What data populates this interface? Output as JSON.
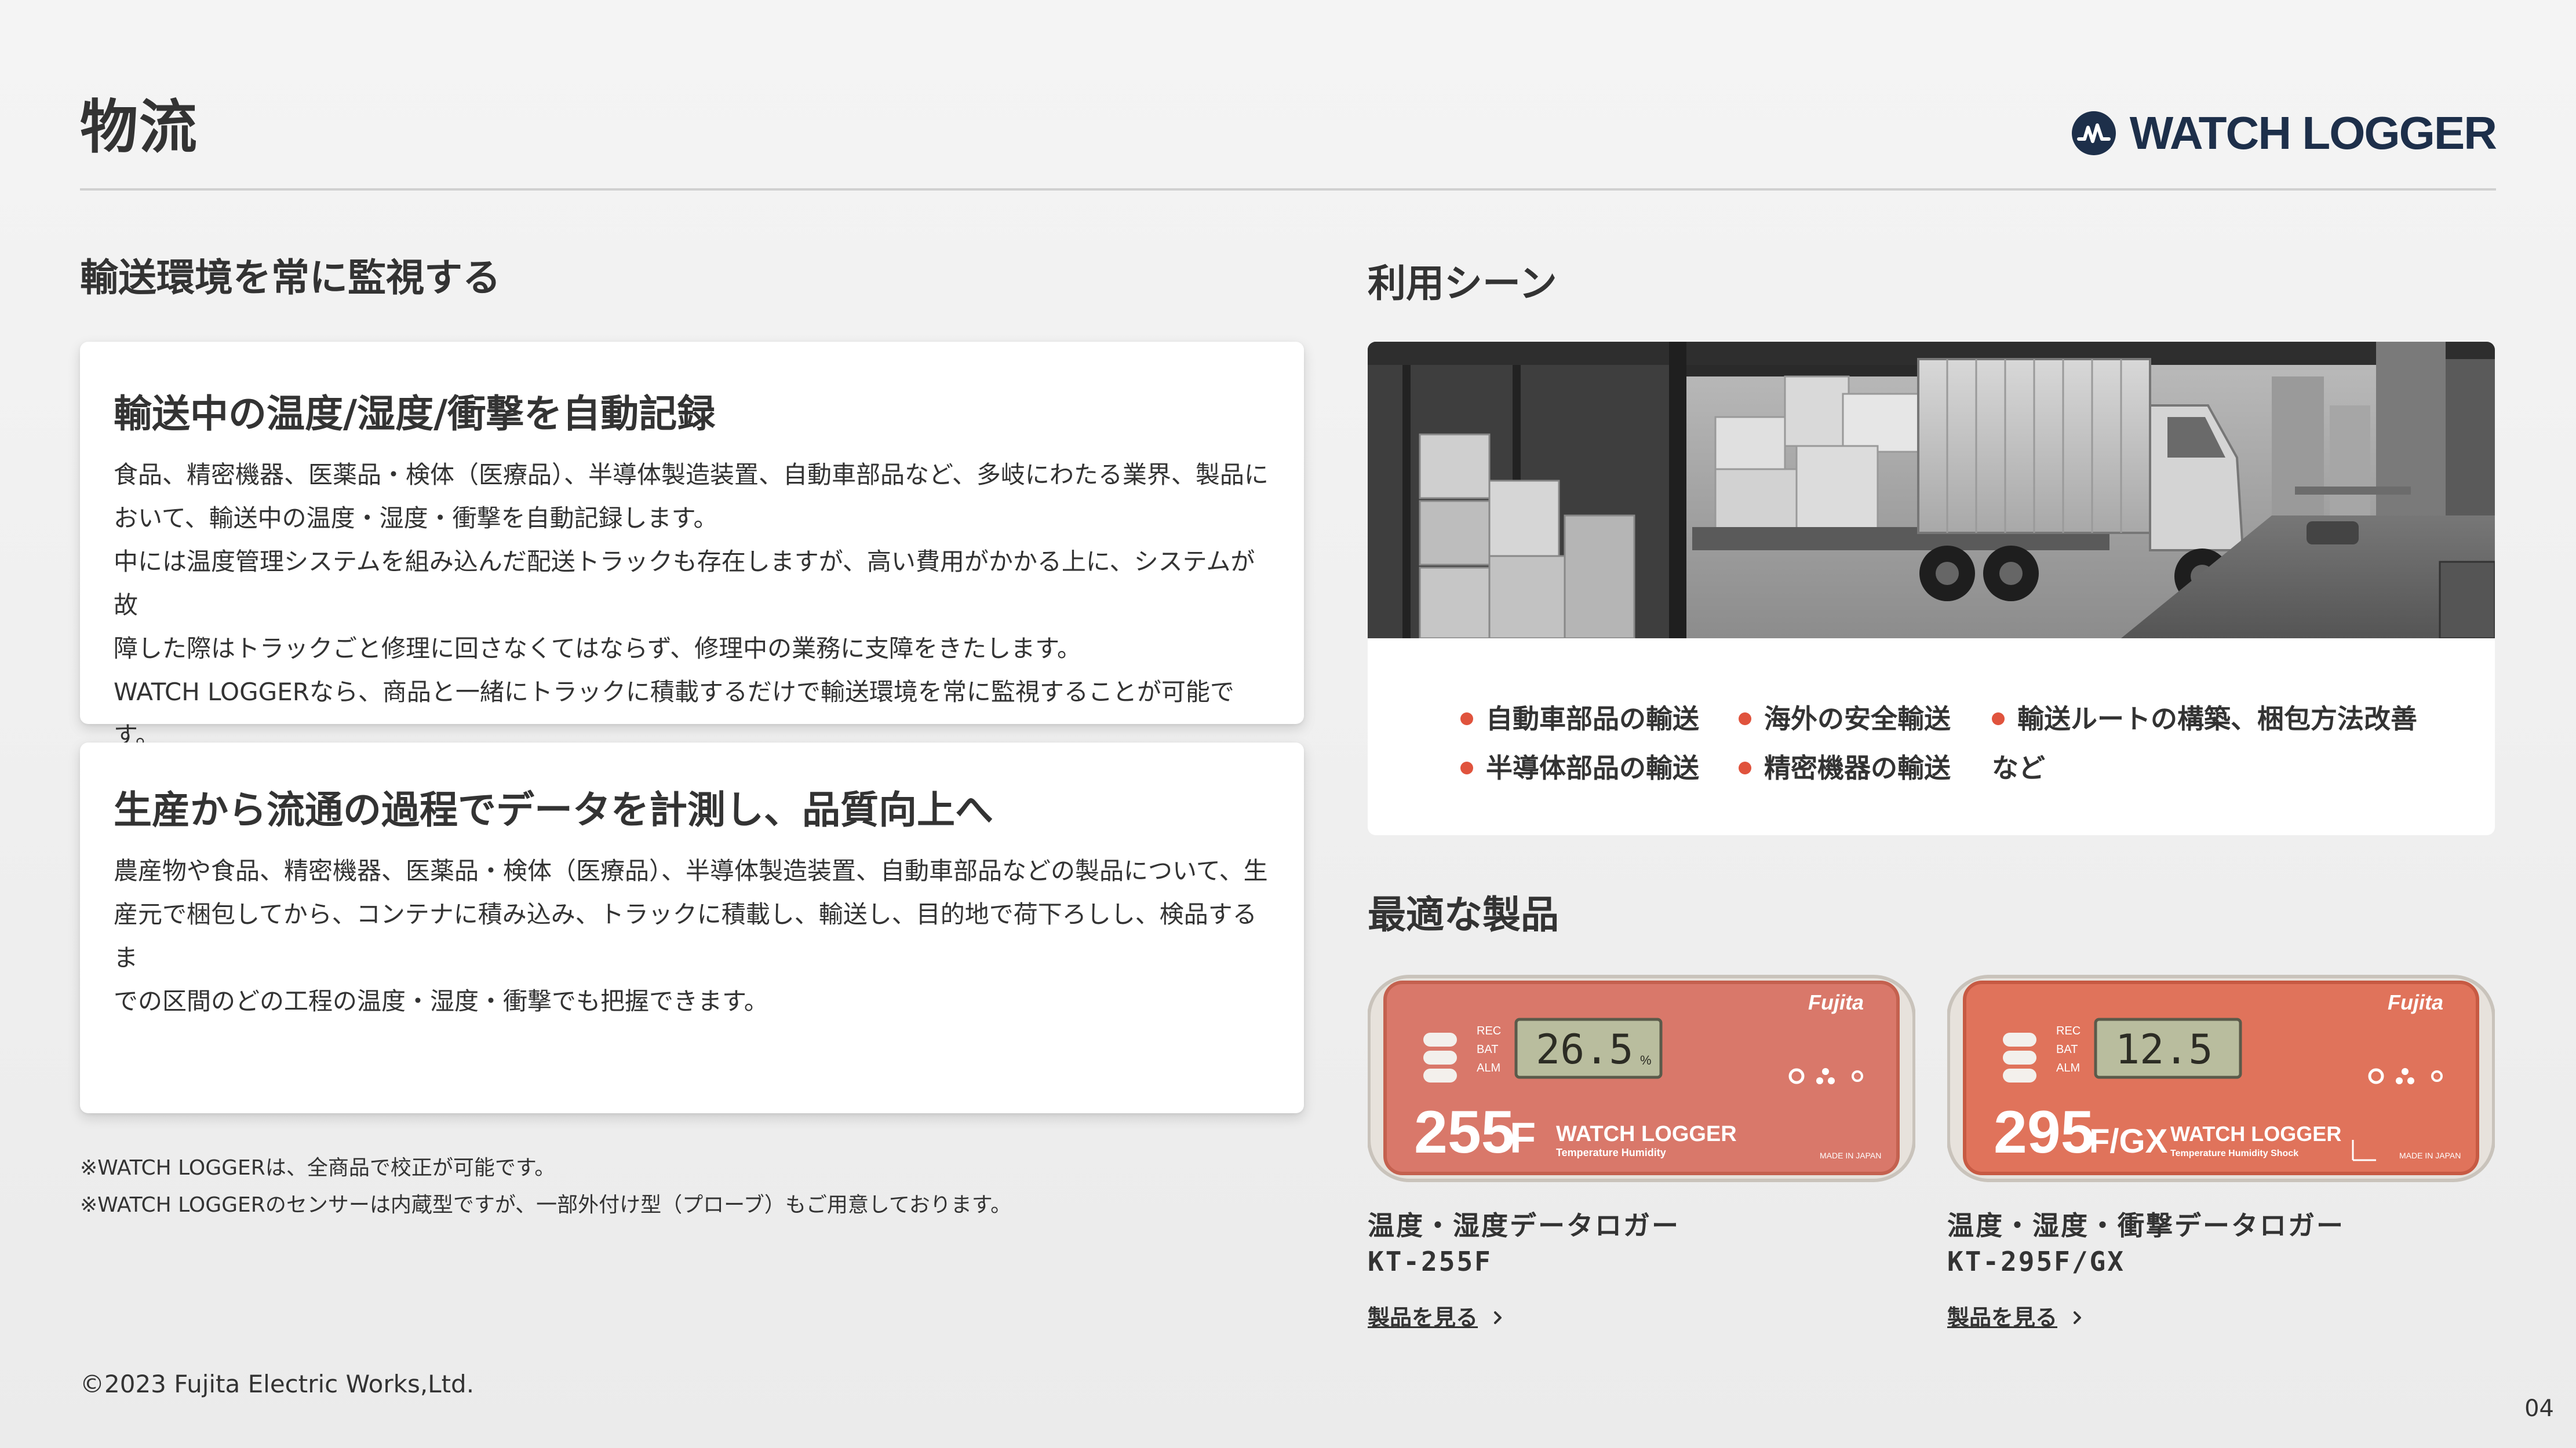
{
  "header": {
    "title": "物流",
    "logo_text": "WATCH LOGGER"
  },
  "left": {
    "heading": "輸送環境を常に監視する",
    "card1": {
      "title": "輸送中の温度/湿度/衝撃を自動記録",
      "lines": [
        "食品、精密機器、医薬品・検体（医療品）、半導体製造装置、自動車部品など、多岐にわたる業界、製品に",
        "おいて、輸送中の温度・湿度・衝撃を自動記録します。",
        "中には温度管理システムを組み込んだ配送トラックも存在しますが、高い費用がかかる上に、システムが故",
        "障した際はトラックごと修理に回さなくてはならず、修理中の業務に支障をきたします。",
        "WATCH LOGGERなら、商品と一緒にトラックに積載するだけで輸送環境を常に監視することが可能です。"
      ]
    },
    "card2": {
      "title": "生産から流通の過程でデータを計測し、品質向上へ",
      "lines": [
        "農産物や食品、精密機器、医薬品・検体（医療品）、半導体製造装置、自動車部品などの製品について、生",
        "産元で梱包してから、コンテナに積み込み、トラックに積載し、輸送し、目的地で荷下ろしし、検品するま",
        "での区間のどの工程の温度・湿度・衝撃でも把握できます。"
      ]
    },
    "notes": [
      "※WATCH LOGGERは、全商品で校正が可能です。",
      "※WATCH LOGGERのセンサーは内蔵型ですが、一部外付け型（プローブ）もご用意しております。"
    ]
  },
  "scenes": {
    "heading": "利用シーン",
    "items": [
      "自動車部品の輸送",
      "海外の安全輸送",
      "輸送ルートの構築、梱包方法改善",
      "半導体部品の輸送",
      "精密機器の輸送"
    ],
    "etc": "など"
  },
  "products": {
    "heading": "最適な製品",
    "items": [
      {
        "name": "温度・湿度データロガー",
        "model": "KT-255F",
        "link": "製品を見る",
        "device": {
          "brand": "Fujita",
          "display": "26.5",
          "display_unit": "%",
          "model_number": "255",
          "model_suffix": "F",
          "device_brand": "WATCH LOGGER",
          "subtitle": "Temperature  Humidity",
          "origin": "MADE IN JAPAN",
          "leds": [
            "REC",
            "BAT",
            "ALM"
          ]
        }
      },
      {
        "name": "温度・湿度・衝撃データロガー",
        "model": "KT-295F/GX",
        "link": "製品を見る",
        "device": {
          "brand": "Fujita",
          "display": "12.5",
          "display_unit": "",
          "model_number": "295",
          "model_suffix": "F/GX",
          "device_brand": "WATCH LOGGER",
          "subtitle": "Temperature  Humidity  Shock",
          "origin": "MADE IN JAPAN",
          "leds": [
            "REC",
            "BAT",
            "ALM"
          ]
        }
      }
    ]
  },
  "footer": {
    "copyright": "©2023 Fujita Electric Works,Ltd.",
    "page_number": "04"
  },
  "colors": {
    "accent": "#e0533d",
    "logo_navy": "#1d2f4a",
    "device_body": "#d9786a"
  }
}
